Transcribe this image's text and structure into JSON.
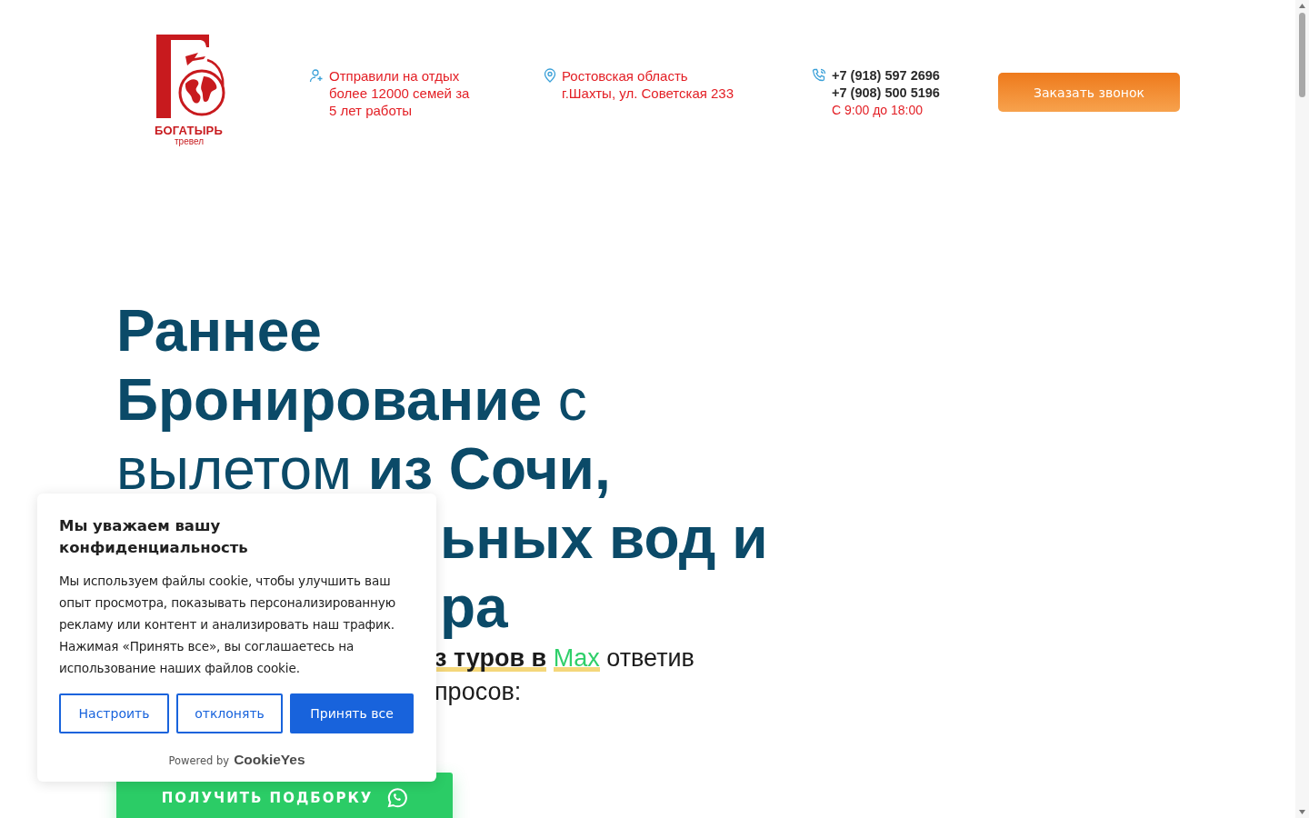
{
  "header": {
    "logo": {
      "name": "БОГАТЫРЬ",
      "tagline": "тревел"
    },
    "info": [
      {
        "kind": "families",
        "lines": [
          "Отправили на отдых",
          "более 12000 семей за",
          "5 лет работы"
        ]
      },
      {
        "kind": "address",
        "lines": [
          "Ростовская область",
          "г.Шахты, ул. Советская 233"
        ]
      },
      {
        "kind": "phone",
        "lines": [
          "+7 (918) 597 2696",
          "+7 (908) 500 5196"
        ],
        "hours": "С 9:00 до 18:00"
      }
    ],
    "button": "Заказать звонок"
  },
  "hero": {
    "headline": [
      {
        "text": "**Раннее**",
        "kind": "full"
      },
      {
        "text": "**Бронирование** с",
        "kind": "full"
      },
      {
        "text": "вылетом **из Сочи,**",
        "kind": "full"
      },
      {
        "text": "**ьных вод и**",
        "kind": "partial"
      },
      {
        "text": "**ра**",
        "kind": "partial"
      }
    ],
    "subtitle": [
      {
        "segments": [
          {
            "text": "з туров в",
            "kind": "bold"
          },
          {
            "text": "Max",
            "kind": "brand"
          },
          {
            "text": "ответив",
            "kind": "plain"
          }
        ]
      },
      {
        "segments": [
          {
            "text": "просов:",
            "kind": "plain"
          }
        ]
      }
    ],
    "cta": "ПОЛУЧИТЬ ПОДБОРКУ"
  },
  "cookie_banner": {
    "title": "Мы уважаем вашу конфиденциальность",
    "text": "Мы используем файлы cookie, чтобы улучшить ваш опыт просмотра, показывать персонализированную рекламу или контент и анализировать наш трафик. Нажимая «Принять все», вы соглашаетесь на использование наших файлов cookie.",
    "buttons": [
      {
        "label": "Настроить",
        "kind": "outline"
      },
      {
        "label": "отклонять",
        "kind": "outline"
      },
      {
        "label": "Принять все",
        "kind": "primary"
      }
    ],
    "powered_by": "Powered by",
    "brand": "CookieYes"
  }
}
